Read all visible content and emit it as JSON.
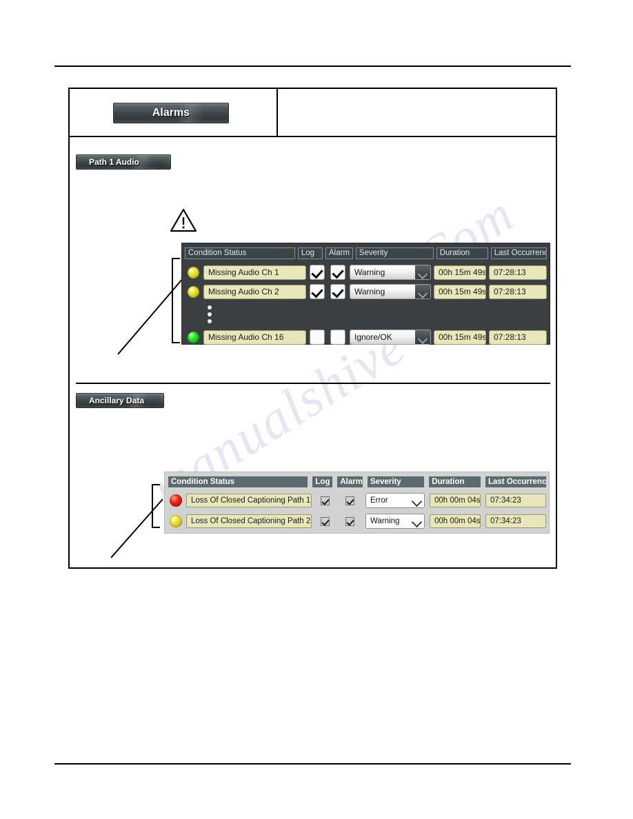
{
  "figure": {
    "title_plate": "Alarms",
    "sections": [
      {
        "plate": "Path 1 Audio"
      },
      {
        "plate": "Ancillary Data"
      }
    ],
    "warning_icon": "warning-triangle-icon"
  },
  "table_audio": {
    "headers": {
      "status": "Condition Status",
      "log": "Log",
      "alarm": "Alarm",
      "severity": "Severity",
      "duration": "Duration",
      "last": "Last Occurrence"
    },
    "rows": [
      {
        "led": "yellow",
        "name": "Missing Audio Ch 1",
        "log": true,
        "alarm": true,
        "severity": "Warning",
        "duration": "00h 15m 49s",
        "last": "07:28:13"
      },
      {
        "led": "yellow",
        "name": "Missing Audio Ch 2",
        "log": true,
        "alarm": true,
        "severity": "Warning",
        "duration": "00h 15m 49s",
        "last": "07:28:13"
      },
      {
        "led": "green",
        "name": "Missing Audio Ch 16",
        "log": false,
        "alarm": false,
        "severity": "Ignore/OK",
        "duration": "00h 15m 49s",
        "last": "07:28:13"
      }
    ]
  },
  "table_ancillary": {
    "headers": {
      "status": "Condition Status",
      "log": "Log",
      "alarm": "Alarm",
      "severity": "Severity",
      "duration": "Duration",
      "last": "Last Occurrence"
    },
    "rows": [
      {
        "led": "red",
        "name": "Loss Of Closed Captioning Path 1",
        "log": true,
        "alarm": true,
        "severity": "Error",
        "duration": "00h 00m 04s",
        "last": "07:34:23"
      },
      {
        "led": "yellow",
        "name": "Loss Of Closed Captioning Path 2",
        "log": true,
        "alarm": true,
        "severity": "Warning",
        "duration": "00h 00m 04s",
        "last": "07:34:23"
      }
    ]
  },
  "watermark": {
    "line_a": "manualshive",
    "line_b": "Com"
  },
  "colors": {
    "panel_dark": "#3b3f42",
    "panel_light": "#d2d2d2",
    "field_cream": "#e8e7bc",
    "header_light": "#5b6a6e",
    "led_yellow": "#e8e23a",
    "led_green": "#2ee62e",
    "led_red": "#ee2a12"
  }
}
